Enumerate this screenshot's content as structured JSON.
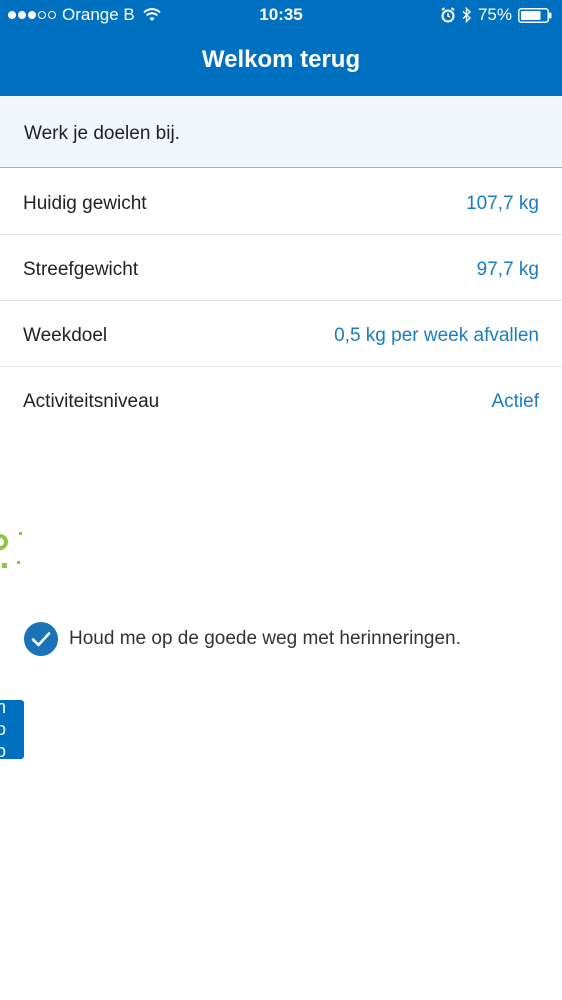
{
  "status_bar": {
    "carrier": "Orange B",
    "time": "10:35",
    "battery": "75%"
  },
  "nav": {
    "title": "Welkom terug"
  },
  "intro": {
    "text": "Werk je doelen bij."
  },
  "goals": [
    {
      "label": "Huidig gewicht",
      "value": "107,7 kg"
    },
    {
      "label": "Streefgewicht",
      "value": "97,7 kg"
    },
    {
      "label": "Weekdoel",
      "value": "0,5 kg per week afvallen"
    },
    {
      "label": "Activiteitsniveau",
      "value": "Actief"
    }
  ],
  "reminder": {
    "label": "Houd me op de goede weg met herinneringen.",
    "checked": true
  },
  "colors": {
    "brand_blue": "#0070c0",
    "value_blue": "#1a7cc0",
    "intro_background": "#f0f6fb",
    "accent_green": "#8cc63f"
  },
  "icons": {
    "wifi": "wifi-icon",
    "alarm": "alarm-icon",
    "bluetooth": "bluetooth-icon",
    "battery": "battery-icon",
    "checkbox": "checkmark-icon"
  }
}
